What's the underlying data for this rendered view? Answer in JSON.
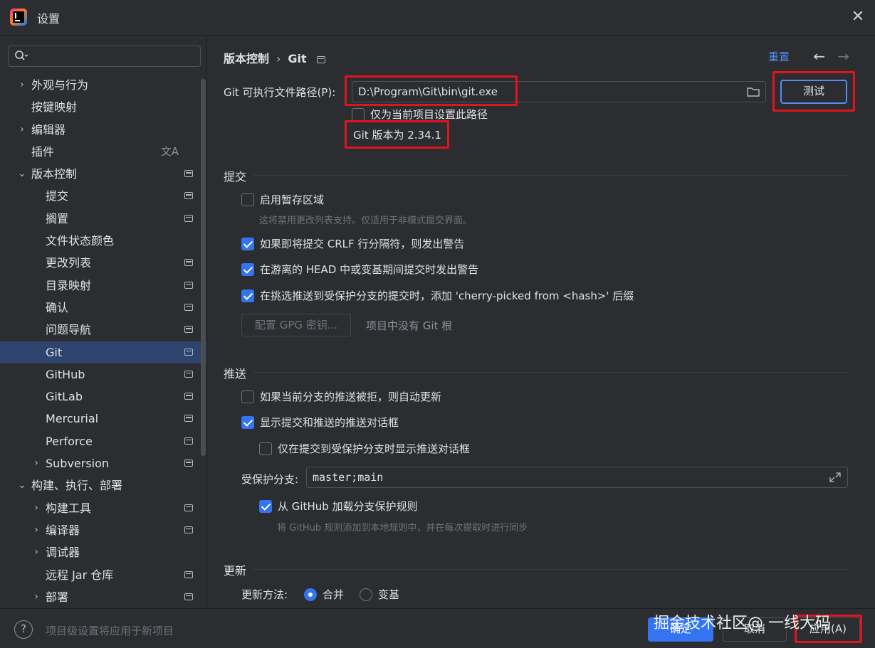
{
  "window": {
    "title": "设置",
    "close": "✕"
  },
  "search": {
    "placeholder": ""
  },
  "sidebar": {
    "items": [
      {
        "label": "外观与行为",
        "level": 0,
        "arrow": "›"
      },
      {
        "label": "按键映射",
        "level": 0
      },
      {
        "label": "编辑器",
        "level": 0,
        "arrow": "›"
      },
      {
        "label": "插件",
        "level": 0
      },
      {
        "label": "版本控制",
        "level": 0,
        "arrow": "⌄"
      },
      {
        "label": "提交",
        "level": 1
      },
      {
        "label": "搁置",
        "level": 1
      },
      {
        "label": "文件状态颜色",
        "level": 1
      },
      {
        "label": "更改列表",
        "level": 1
      },
      {
        "label": "目录映射",
        "level": 1
      },
      {
        "label": "确认",
        "level": 1
      },
      {
        "label": "问题导航",
        "level": 1
      },
      {
        "label": "Git",
        "level": 1
      },
      {
        "label": "GitHub",
        "level": 1
      },
      {
        "label": "GitLab",
        "level": 1
      },
      {
        "label": "Mercurial",
        "level": 1
      },
      {
        "label": "Perforce",
        "level": 1
      },
      {
        "label": "Subversion",
        "level": 1,
        "arrow": "›"
      },
      {
        "label": "构建、执行、部署",
        "level": 0,
        "arrow": "⌄"
      },
      {
        "label": "构建工具",
        "level": 1,
        "arrow": "›"
      },
      {
        "label": "编译器",
        "level": 1,
        "arrow": "›"
      },
      {
        "label": "调试器",
        "level": 1,
        "arrow": "›"
      },
      {
        "label": "远程 Jar 仓库",
        "level": 1
      },
      {
        "label": "部署",
        "level": 1,
        "arrow": "›"
      }
    ]
  },
  "header": {
    "crumb_parent": "版本控制",
    "crumb_sep": "›",
    "crumb_current": "Git",
    "reset": "重置",
    "back": "←",
    "forward": "→"
  },
  "git": {
    "path_label": "Git 可执行文件路径(P):",
    "path_value": "D:\\Program\\Git\\bin\\git.exe",
    "test_button": "测试",
    "project_only": "仅为当前项目设置此路径",
    "version_text": "Git 版本为 2.34.1"
  },
  "commit": {
    "title": "提交",
    "staging": "启用暂存区域",
    "staging_hint": "这将禁用更改列表支持。仅适用于非模式提交界面。",
    "crlf": "如果即将提交 CRLF 行分隔符，则发出警告",
    "detached": "在游离的 HEAD 中或变基期间提交时发出警告",
    "cherry": "在挑选推送到受保护分支的提交时，添加 'cherry-picked from <hash>' 后缀",
    "gpg_button": "配置 GPG 密钥...",
    "gpg_hint": "项目中没有 Git 根"
  },
  "push": {
    "title": "推送",
    "auto_update": "如果当前分支的推送被拒，则自动更新",
    "show_dialog": "显示提交和推送的推送对话框",
    "protected_only": "仅在提交到受保护分支时显示推送对话框",
    "protected_label": "受保护分支:",
    "protected_value": "master;main",
    "github_rules": "从 GitHub 加载分支保护规则",
    "github_hint": "将 GitHub 规则添加到本地规则中，并在每次提取时进行同步"
  },
  "update": {
    "title": "更新",
    "method_label": "更新方法:",
    "merge": "合并",
    "rebase": "变基"
  },
  "footer": {
    "help": "?",
    "text": "项目级设置将应用于新项目",
    "ok": "确定",
    "cancel": "取消",
    "apply": "应用(A)",
    "watermark": "掘金技术社区@ 一线大码"
  }
}
